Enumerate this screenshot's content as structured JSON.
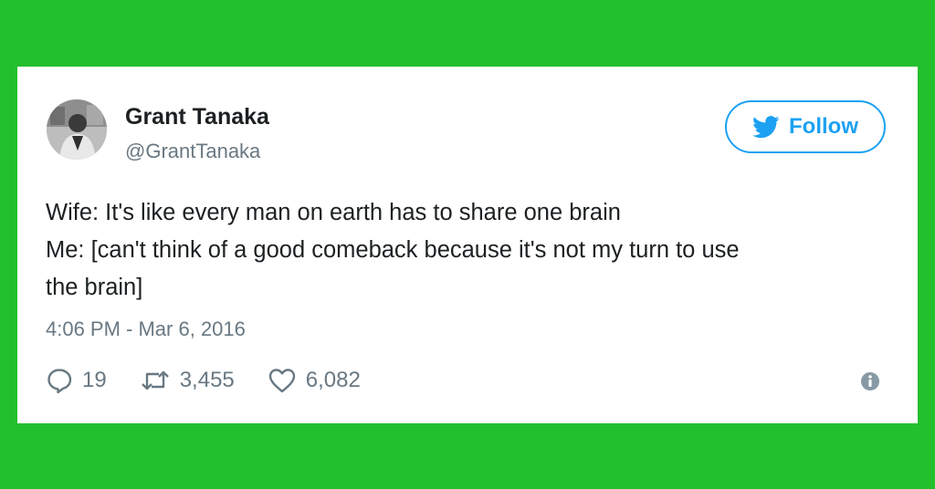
{
  "tweet": {
    "author": {
      "name": "Grant Tanaka",
      "handle": "@GrantTanaka",
      "avatar_icon": "avatar-photo"
    },
    "follow_button": {
      "label": "Follow",
      "icon": "twitter-bird-icon",
      "color": "#1da1f2"
    },
    "text_lines": [
      "Wife: It's like every man on earth has to share one brain",
      "Me: [can't think of a good comeback because it's not my turn to use",
      "the brain]"
    ],
    "timestamp": "4:06 PM - Mar 6, 2016",
    "actions": {
      "replies": {
        "icon": "reply-icon",
        "count": "19"
      },
      "retweets": {
        "icon": "retweet-icon",
        "count": "3,455"
      },
      "likes": {
        "icon": "heart-icon",
        "count": "6,082"
      },
      "info": {
        "icon": "info-icon"
      }
    }
  },
  "colors": {
    "background": "#22c02d",
    "card": "#ffffff",
    "text": "#1c2022",
    "muted": "#697882",
    "accent": "#1da1f2"
  }
}
